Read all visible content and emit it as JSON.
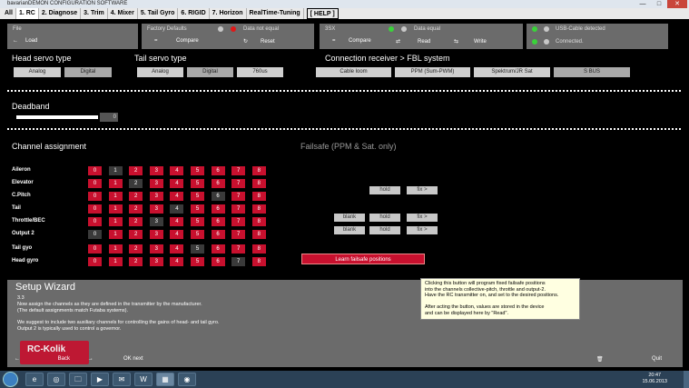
{
  "window": {
    "title": "bavarianDEMON CONFIGURATION SOFTWARE",
    "minimize": "—",
    "maximize": "□",
    "close": "✕"
  },
  "tabs": [
    {
      "label": "All"
    },
    {
      "label": "1. RC"
    },
    {
      "label": "2. Diagnose"
    },
    {
      "label": "3. Trim"
    },
    {
      "label": "4. Mixer"
    },
    {
      "label": "5. Tail Gyro"
    },
    {
      "label": "6. RIGID"
    },
    {
      "label": "7. Horizon"
    },
    {
      "label": "RealTime-Tuning"
    },
    {
      "label": "[ HELP ]"
    }
  ],
  "panels": {
    "file": {
      "title": "File",
      "load_sym": "←",
      "load": "Load"
    },
    "factory": {
      "title": "Factory Defaults",
      "status": "Data not equal",
      "compare_sym": "=",
      "compare": "Compare",
      "reset_sym": "↻",
      "reset": "Reset"
    },
    "bx": {
      "title": "3SX",
      "status": "Data equal",
      "compare_sym": "=",
      "compare": "Compare",
      "read_sym": "⇄",
      "read": "Read",
      "write_sym": "⇆",
      "write": "Write"
    },
    "usb": {
      "detected": "USB-Cable detected",
      "connected": "Connected."
    }
  },
  "head_servo": {
    "title": "Head servo type",
    "options": [
      "Analog",
      "Digital"
    ],
    "selected": "Digital"
  },
  "tail_servo": {
    "title": "Tail servo type",
    "options": [
      "Analog",
      "Digital",
      "760us"
    ],
    "selected": "Digital"
  },
  "receiver": {
    "title": "Connection receiver > FBL system",
    "options": [
      "Cable loom",
      "PPM (Sum-PWM)",
      "Spektrum/JR Sat",
      "S BUS"
    ],
    "selected": "S BUS"
  },
  "deadband": {
    "title": "Deadband",
    "value": "0",
    "level": 0.85
  },
  "channel_assignment": {
    "title": "Channel assignment",
    "channels": [
      "0",
      "1",
      "2",
      "3",
      "4",
      "5",
      "6",
      "7",
      "8"
    ],
    "rows": [
      {
        "label": "Aileron",
        "selected": "1"
      },
      {
        "label": "Elevator",
        "selected": "2"
      },
      {
        "label": "C.Pitch",
        "selected": "6"
      },
      {
        "label": "Tail",
        "selected": "4"
      },
      {
        "label": "Throttle/BEC",
        "selected": "3"
      },
      {
        "label": "Output 2",
        "selected": "0"
      },
      {
        "label": "Tail gyo",
        "selected": "5"
      },
      {
        "label": "Head gyro",
        "selected": "7"
      }
    ]
  },
  "failsafe": {
    "title": "Failsafe (PPM & Sat. only)",
    "blank": "blank",
    "hold": "hold",
    "fix": "fix >",
    "learn": "Learn failsafe positions"
  },
  "tooltip": {
    "lines": [
      "Clicking this button will program fixed failsafe positions",
      "into the channels collective-pitch, throttle and output-2.",
      "Have the RC transmitter on, and set to the desired positions.",
      "",
      "After acting the button, values are stored in the device",
      "and can be displayed here by \"Read\"."
    ]
  },
  "wizard": {
    "title": "Setup Wizard",
    "lines": [
      "3.3",
      "Now assign the channels as they are defined in the transmitter by the manufacturer.",
      "(The default assignments match Futaba systems).",
      "",
      "We suggest to include two auxiliary channels for controlling the gains of head- and tail gyro.",
      "Output 2 is typically used to control a governor."
    ],
    "back_sym": "←",
    "back": "Back",
    "next_sym": "→",
    "ok_next": "OK next",
    "quit_sym": "🗑",
    "quit": "Quit"
  },
  "logo": {
    "text": "RC-Kolik"
  },
  "taskbar": {
    "time": "20:47",
    "date": "15.06.2013",
    "apps": [
      "e",
      "◎",
      "🗀",
      "▶",
      "✉",
      "W",
      "▦",
      "◉"
    ]
  },
  "colors": {
    "channel": "#c8102e",
    "channel_selected": "#3a3a3a",
    "panel": "#6b6b6b"
  }
}
